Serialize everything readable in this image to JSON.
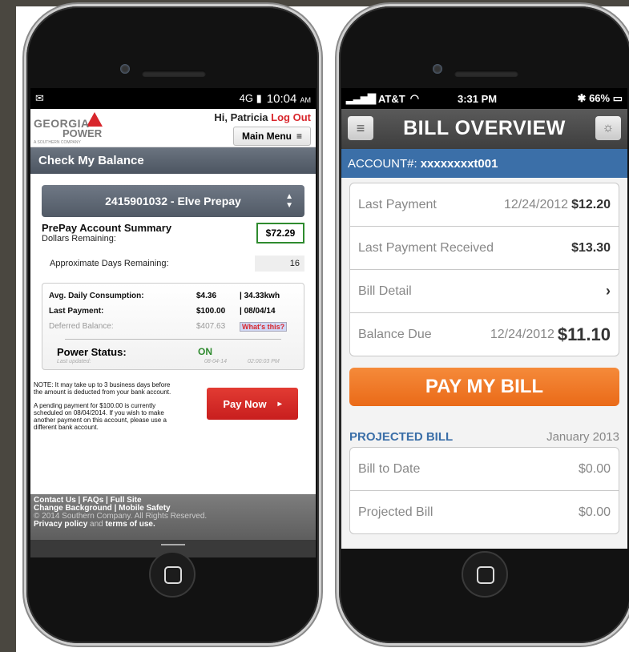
{
  "left_phone": {
    "status_bar": {
      "icons": "✉",
      "right_icons": "4G ▮",
      "time": "10:04",
      "ampm": "AM"
    },
    "header": {
      "logo_line1": "GEORGIA",
      "logo_line2": "POWER",
      "logo_line3": "A SOUTHERN COMPANY",
      "greeting": "Hi, Patricia",
      "logout": "Log Out",
      "main_menu": "Main Menu"
    },
    "title": "Check My Balance",
    "account_select": "2415901032 - Elve Prepay",
    "summary": {
      "heading": "PrePay Account Summary",
      "dollars_label": "Dollars Remaining:",
      "amount": "$72.29",
      "days_label": "Approximate Days Remaining:",
      "days_value": "16"
    },
    "stats": {
      "avg_label": "Avg. Daily Consumption:",
      "avg_dollars": "$4.36",
      "avg_kwh": "| 34.33kwh",
      "last_label": "Last Payment:",
      "last_amount": "$100.00",
      "last_date": "| 08/04/14",
      "deferred_label": "Deferred Balance:",
      "deferred_amount": "$407.63",
      "whats_this": "What's this?",
      "power_label": "Power Status:",
      "power_value": "ON",
      "updated_label": "Last updated:",
      "updated_date": "08-04-14",
      "updated_time": "02:00:03 PM"
    },
    "note1": "NOTE: It may take up to 3 business days before the amount is deducted from your bank account.",
    "note2": "A pending payment for $100.00 is currently scheduled on 08/04/2014. If you wish to make another payment on this account, please use a different bank account.",
    "pay_now": "Pay Now",
    "footer": {
      "links1": "Contact Us | FAQs | Full Site",
      "links2": "Change Background | Mobile Safety",
      "copyright": "© 2014 Southern Company. All Rights Reserved.",
      "privacy": "Privacy policy",
      "and": "and",
      "terms": "terms of use."
    }
  },
  "right_phone": {
    "status_bar": {
      "carrier": "AT&T",
      "time": "3:31 PM",
      "battery": "66%"
    },
    "title": "BILL OVERVIEW",
    "account_label": "ACCOUNT#:",
    "account_number": "xxxxxxxxt001",
    "rows": [
      {
        "label": "Last Payment",
        "date": "12/24/2012",
        "amount": "$12.20"
      },
      {
        "label": "Last Payment Received",
        "amount": "$13.30"
      },
      {
        "label": "Bill Detail",
        "chevron": "›"
      },
      {
        "label": "Balance Due",
        "date": "12/24/2012",
        "amount": "$11.10"
      }
    ],
    "pay_button": "PAY MY BILL",
    "projected": {
      "heading": "PROJECTED BILL",
      "month": "January 2013",
      "rows": [
        {
          "label": "Bill to Date",
          "amount": "$0.00"
        },
        {
          "label": "Projected Bill",
          "amount": "$0.00"
        }
      ]
    }
  }
}
